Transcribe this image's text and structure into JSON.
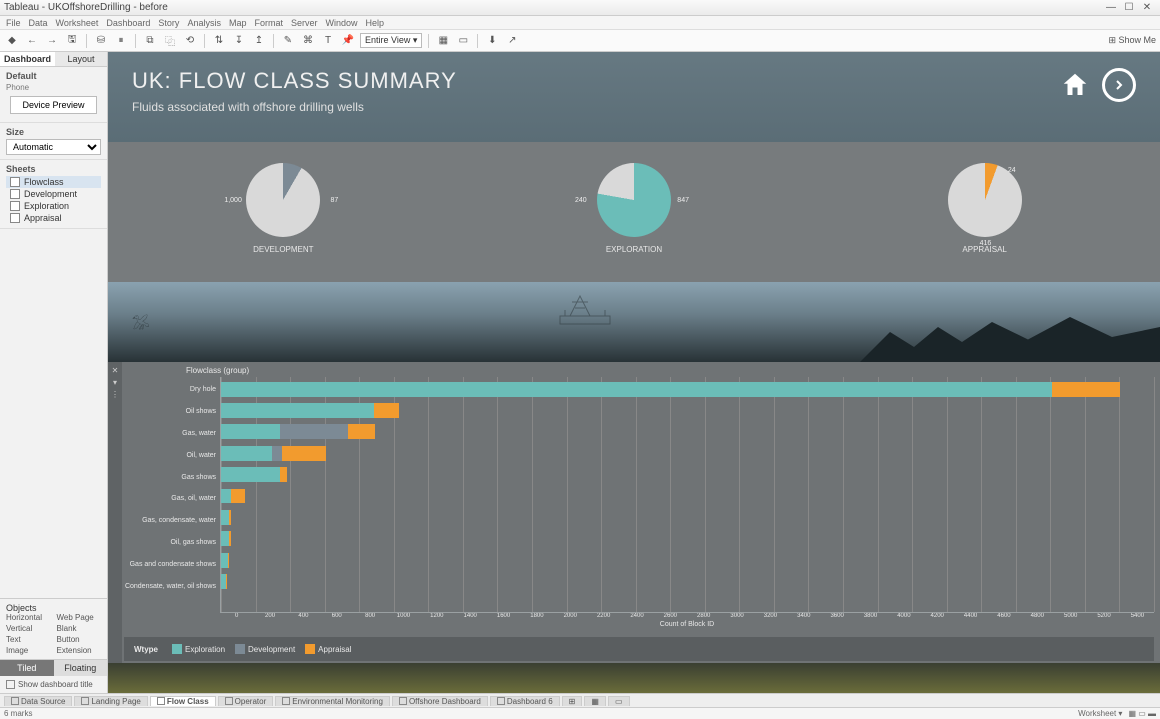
{
  "window": {
    "title": "Tableau - UKOffshoreDrilling - before",
    "min": "—",
    "max": "☐",
    "close": "✕"
  },
  "menu": [
    "File",
    "Data",
    "Worksheet",
    "Dashboard",
    "Story",
    "Analysis",
    "Map",
    "Format",
    "Server",
    "Window",
    "Help"
  ],
  "toolbar": {
    "fit": "Entire View ▾",
    "showme": "⊞ Show Me"
  },
  "side": {
    "tabs": {
      "dashboard": "Dashboard",
      "layout": "Layout"
    },
    "device_label": "Default",
    "device_sub": "Phone",
    "device_btn": "Device Preview",
    "size_label": "Size",
    "size_value": "Automatic",
    "sheets_label": "Sheets",
    "sheets": [
      "Flowclass",
      "Development",
      "Exploration",
      "Appraisal"
    ],
    "objects_label": "Objects",
    "objects": [
      "Horizontal",
      "Web Page",
      "Vertical",
      "Blank",
      "Text",
      "Button",
      "Image",
      "Extension"
    ],
    "tiled": "Tiled",
    "floating": "Floating",
    "show_title": "Show dashboard title"
  },
  "dashboard": {
    "title": "UK: FLOW CLASS SUMMARY",
    "subtitle": "Fluids associated with offshore drilling wells",
    "pies": [
      {
        "name": "DEVELOPMENT",
        "left": "1,000",
        "right": "87"
      },
      {
        "name": "EXPLORATION",
        "left": "240",
        "right": "847"
      },
      {
        "name": "APPRAISAL",
        "right_top": "24",
        "bottom": "416"
      }
    ],
    "bar_title": "Flowclass (group)",
    "xlabel": "Count of Block ID",
    "xticks": [
      "0",
      "200",
      "400",
      "600",
      "800",
      "1000",
      "1200",
      "1400",
      "1600",
      "1800",
      "2000",
      "2200",
      "2400",
      "2600",
      "2800",
      "3000",
      "3200",
      "3400",
      "3600",
      "3800",
      "4000",
      "4200",
      "4400",
      "4600",
      "4800",
      "5000",
      "5200",
      "5400"
    ],
    "legend_title": "Wtype",
    "legend": [
      "Exploration",
      "Development",
      "Appraisal"
    ]
  },
  "chart_data": {
    "type": "bar",
    "orientation": "horizontal-stacked",
    "xlabel": "Count of Block ID",
    "ylabel": "Flowclass (group)",
    "xlim": [
      0,
      5500
    ],
    "categories": [
      "Dry hole",
      "Oil shows",
      "Gas, water",
      "Oil, water",
      "Gas shows",
      "Gas, oil, water",
      "Gas, condensate, water",
      "Oil, gas shows",
      "Gas and condensate shows",
      "Condensate, water, oil shows"
    ],
    "series": [
      {
        "name": "Exploration",
        "color": "#6bbdb8",
        "values": [
          4900,
          900,
          350,
          300,
          350,
          60,
          50,
          50,
          40,
          30
        ]
      },
      {
        "name": "Development",
        "color": "#7c8a95",
        "values": [
          0,
          0,
          400,
          60,
          0,
          0,
          0,
          0,
          0,
          0
        ]
      },
      {
        "name": "Appraisal",
        "color": "#f29b2e",
        "values": [
          400,
          150,
          160,
          260,
          40,
          80,
          10,
          10,
          5,
          5
        ]
      }
    ],
    "pies": [
      {
        "title": "DEVELOPMENT",
        "type": "pie",
        "slices": [
          {
            "label": "1,000",
            "value": 1000,
            "color": "#d9d9d9"
          },
          {
            "label": "87",
            "value": 87,
            "color": "#7c8a95"
          }
        ]
      },
      {
        "title": "EXPLORATION",
        "type": "pie",
        "slices": [
          {
            "label": "240",
            "value": 240,
            "color": "#d9d9d9"
          },
          {
            "label": "847",
            "value": 847,
            "color": "#6bbdb8"
          }
        ]
      },
      {
        "title": "APPRAISAL",
        "type": "pie",
        "slices": [
          {
            "label": "416",
            "value": 416,
            "color": "#d9d9d9"
          },
          {
            "label": "24",
            "value": 24,
            "color": "#f29b2e"
          }
        ]
      }
    ]
  },
  "sheet_tabs": [
    "Data Source",
    "Landing Page",
    "Flow Class",
    "Operator",
    "Environmental Monitoring",
    "Offshore Dashboard",
    "Dashboard 6"
  ],
  "status": {
    "left": "6 marks",
    "right": "Worksheet ▾"
  }
}
